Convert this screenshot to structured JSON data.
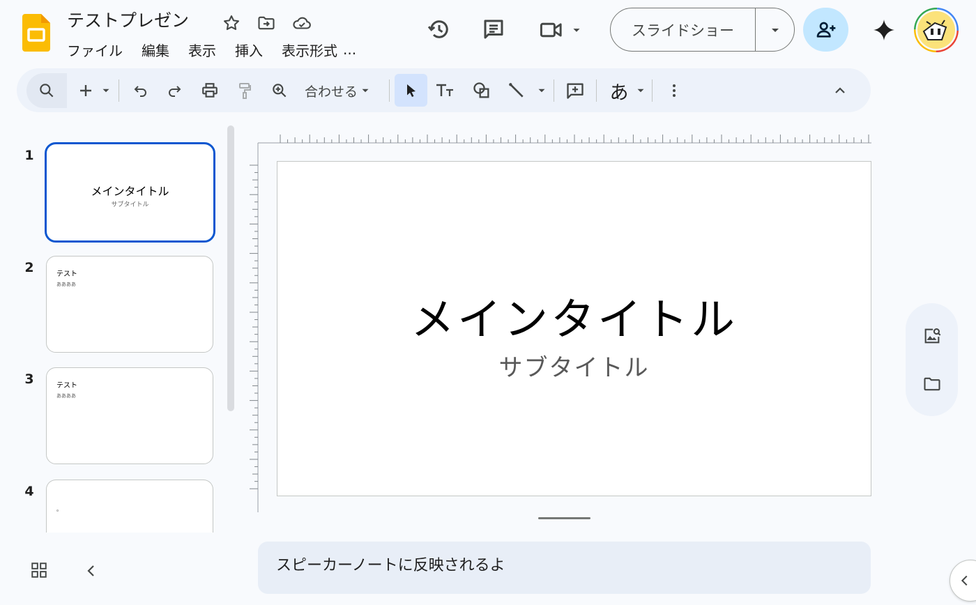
{
  "app": {
    "brand_color": "#fbbc04",
    "accent": "#0b57d0"
  },
  "header": {
    "doc_title": "テストプレゼン",
    "menus": [
      "ファイル",
      "編集",
      "表示",
      "挿入",
      "表示形式"
    ],
    "menu_more": "...",
    "slideshow_label": "スライドショー"
  },
  "toolbar": {
    "zoom_label": "合わせる",
    "font_label": "あ"
  },
  "slides": [
    {
      "number": "1",
      "title": "メインタイトル",
      "subtitle": "サブタイトル"
    },
    {
      "number": "2",
      "heading": "テスト",
      "body": "ああああ"
    },
    {
      "number": "3",
      "heading": "テスト",
      "body": "ああああ"
    },
    {
      "number": "4",
      "body": "。"
    }
  ],
  "canvas": {
    "title": "メインタイトル",
    "subtitle": "サブタイトル"
  },
  "notes": {
    "text": "スピーカーノートに反映されるよ"
  }
}
